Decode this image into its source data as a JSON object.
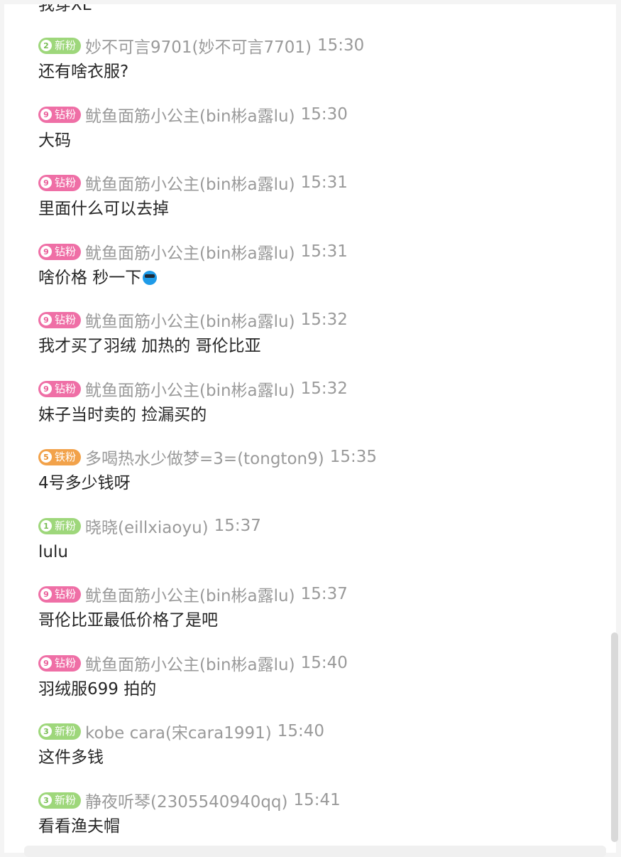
{
  "partial_top_text": "我穿XL",
  "messages": [
    {
      "badge": {
        "level": "2",
        "label": "新粉",
        "type": "new"
      },
      "user": "妙不可言9701(妙不可言7701)",
      "time": "15:30",
      "text": "还有啥衣服?"
    },
    {
      "badge": {
        "level": "9",
        "label": "钻粉",
        "type": "diamond"
      },
      "user": "鱿鱼面筋小公主(bin彬a露lu)",
      "time": "15:30",
      "text": "大码"
    },
    {
      "badge": {
        "level": "9",
        "label": "钻粉",
        "type": "diamond"
      },
      "user": "鱿鱼面筋小公主(bin彬a露lu)",
      "time": "15:31",
      "text": "里面什么可以去掉"
    },
    {
      "badge": {
        "level": "9",
        "label": "钻粉",
        "type": "diamond"
      },
      "user": "鱿鱼面筋小公主(bin彬a露lu)",
      "time": "15:31",
      "text": "啥价格 秒一下",
      "emoji": "cool-sunglasses-emoji"
    },
    {
      "badge": {
        "level": "9",
        "label": "钻粉",
        "type": "diamond"
      },
      "user": "鱿鱼面筋小公主(bin彬a露lu)",
      "time": "15:32",
      "text": "我才买了羽绒 加热的 哥伦比亚"
    },
    {
      "badge": {
        "level": "9",
        "label": "钻粉",
        "type": "diamond"
      },
      "user": "鱿鱼面筋小公主(bin彬a露lu)",
      "time": "15:32",
      "text": "妹子当时卖的 捡漏买的"
    },
    {
      "badge": {
        "level": "5",
        "label": "铁粉",
        "type": "iron"
      },
      "user": "多喝热水少做梦=3=(tongton9)",
      "time": "15:35",
      "text": "4号多少钱呀"
    },
    {
      "badge": {
        "level": "1",
        "label": "新粉",
        "type": "new"
      },
      "user": "晓晓(eillxiaoyu)",
      "time": "15:37",
      "text": "lulu"
    },
    {
      "badge": {
        "level": "9",
        "label": "钻粉",
        "type": "diamond"
      },
      "user": "鱿鱼面筋小公主(bin彬a露lu)",
      "time": "15:37",
      "text": "哥伦比亚最低价格了是吧"
    },
    {
      "badge": {
        "level": "9",
        "label": "钻粉",
        "type": "diamond"
      },
      "user": "鱿鱼面筋小公主(bin彬a露lu)",
      "time": "15:40",
      "text": "羽绒服699 拍的"
    },
    {
      "badge": {
        "level": "3",
        "label": "新粉",
        "type": "new"
      },
      "user": "kobe cara(宋cara1991)",
      "time": "15:40",
      "text": "这件多钱"
    },
    {
      "badge": {
        "level": "3",
        "label": "新粉",
        "type": "new"
      },
      "user": "静夜听琴(2305540940qq)",
      "time": "15:41",
      "text": "看看渔夫帽"
    }
  ]
}
